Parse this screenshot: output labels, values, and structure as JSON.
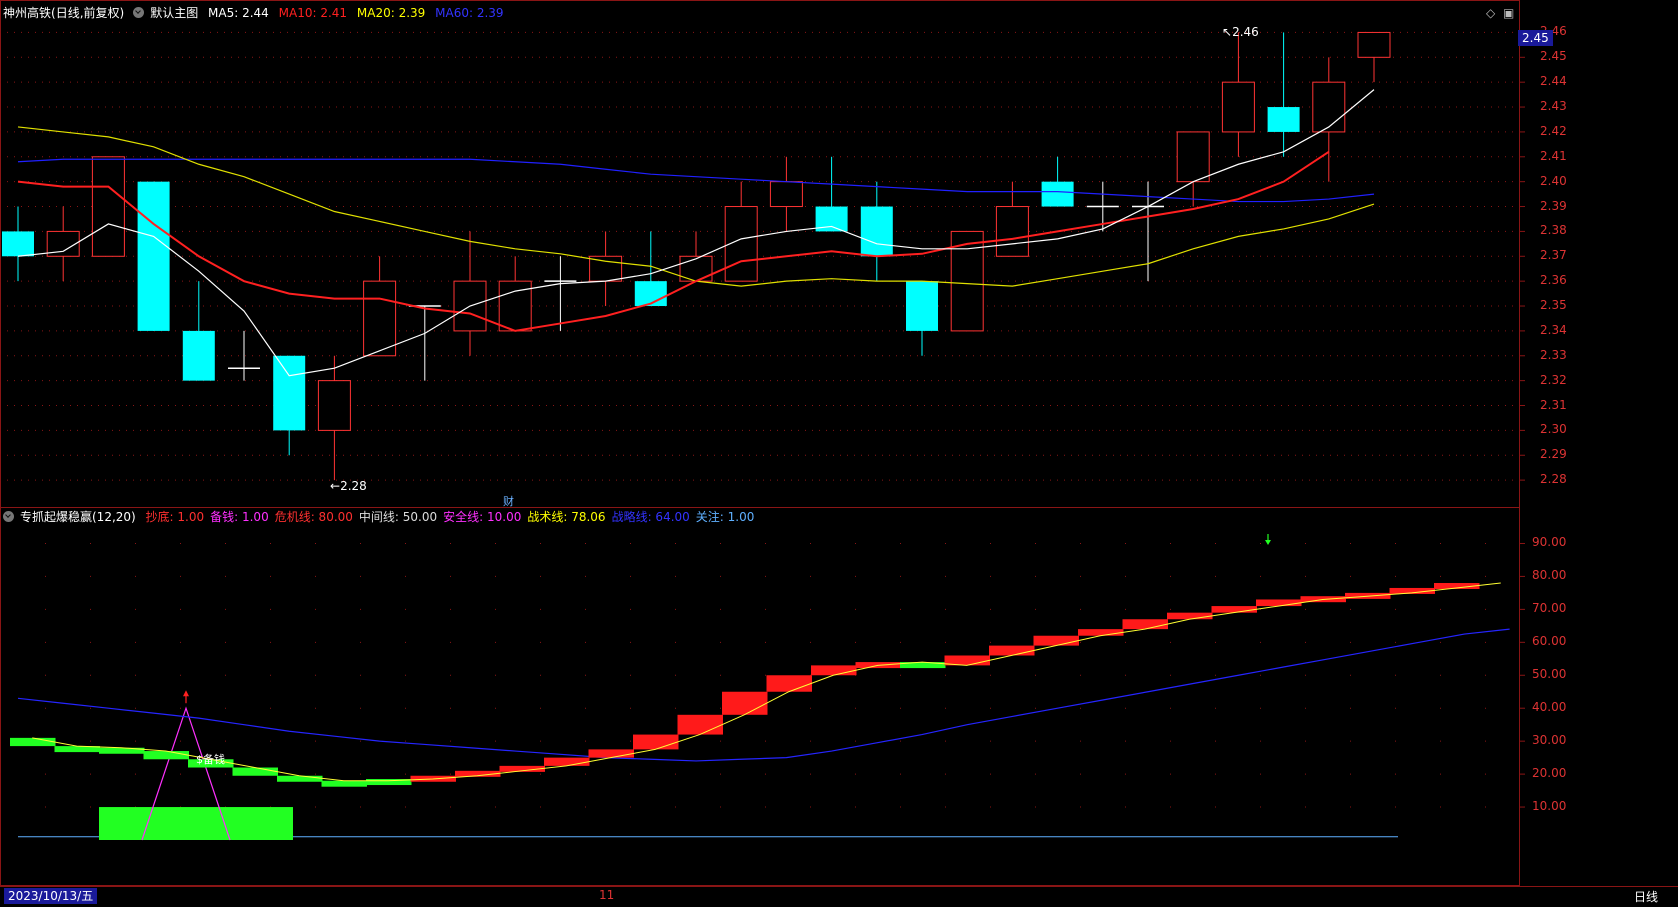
{
  "header": {
    "stock": "神州高铁",
    "period_mode": "(日线,前复权)",
    "template": "默认主图",
    "ma5": "MA5: 2.44",
    "ma10": "MA10: 2.41",
    "ma20": "MA20: 2.39",
    "ma60": "MA60: 2.39"
  },
  "indicator_header": {
    "name": "专抓起爆稳赢(12,20)",
    "items": [
      {
        "text": "抄底: 1.00",
        "color": "#ff3030"
      },
      {
        "text": "备钱: 1.00",
        "color": "#ff30ff"
      },
      {
        "text": "危机线: 80.00",
        "color": "#ff3030"
      },
      {
        "text": "中间线: 50.00",
        "color": "#dddddd"
      },
      {
        "text": "安全线: 10.00",
        "color": "#ff30ff"
      },
      {
        "text": "战术线: 78.06",
        "color": "#ffff00"
      },
      {
        "text": "战略线: 64.00",
        "color": "#3333ff"
      },
      {
        "text": "关注: 1.00",
        "color": "#5fb0ff"
      }
    ]
  },
  "current_price": "2.45",
  "high_annotation": "2.46",
  "low_annotation": "2.28",
  "finance_marker": "财",
  "signal_label": "$备钱",
  "bottom": {
    "date": "2023/10/13/五",
    "month": "11",
    "period": "日线"
  },
  "colors": {
    "up": "#ff3333",
    "down": "#00ffff",
    "ma5": "#ffffff",
    "ma10": "#ff2020",
    "ma20": "#e0e000",
    "ma60": "#2020ff",
    "grid": "#8a1515"
  },
  "chart_data": [
    {
      "type": "candlestick",
      "ylim": [
        2.27,
        2.465
      ],
      "yticks": [
        "2.46",
        "2.45",
        "2.44",
        "2.43",
        "2.42",
        "2.41",
        "2.40",
        "2.39",
        "2.38",
        "2.37",
        "2.36",
        "2.35",
        "2.34",
        "2.33",
        "2.32",
        "2.31",
        "2.30",
        "2.29",
        "2.28"
      ],
      "candles": [
        {
          "o": 2.38,
          "c": 2.37,
          "h": 2.39,
          "l": 2.36
        },
        {
          "o": 2.37,
          "c": 2.38,
          "h": 2.39,
          "l": 2.36
        },
        {
          "o": 2.37,
          "c": 2.41,
          "h": 2.41,
          "l": 2.37
        },
        {
          "o": 2.4,
          "c": 2.34,
          "h": 2.4,
          "l": 2.34
        },
        {
          "o": 2.34,
          "c": 2.32,
          "h": 2.36,
          "l": 2.32
        },
        {
          "o": 2.325,
          "c": 2.325,
          "h": 2.34,
          "l": 2.32
        },
        {
          "o": 2.33,
          "c": 2.3,
          "h": 2.33,
          "l": 2.29
        },
        {
          "o": 2.3,
          "c": 2.32,
          "h": 2.33,
          "l": 2.28
        },
        {
          "o": 2.33,
          "c": 2.36,
          "h": 2.37,
          "l": 2.33
        },
        {
          "o": 2.35,
          "c": 2.35,
          "h": 2.35,
          "l": 2.32
        },
        {
          "o": 2.34,
          "c": 2.36,
          "h": 2.38,
          "l": 2.33
        },
        {
          "o": 2.34,
          "c": 2.36,
          "h": 2.37,
          "l": 2.34
        },
        {
          "o": 2.36,
          "c": 2.36,
          "h": 2.37,
          "l": 2.34
        },
        {
          "o": 2.36,
          "c": 2.37,
          "h": 2.38,
          "l": 2.35
        },
        {
          "o": 2.36,
          "c": 2.35,
          "h": 2.38,
          "l": 2.35
        },
        {
          "o": 2.36,
          "c": 2.37,
          "h": 2.38,
          "l": 2.36
        },
        {
          "o": 2.36,
          "c": 2.39,
          "h": 2.4,
          "l": 2.36
        },
        {
          "o": 2.39,
          "c": 2.4,
          "h": 2.41,
          "l": 2.38
        },
        {
          "o": 2.39,
          "c": 2.38,
          "h": 2.41,
          "l": 2.38
        },
        {
          "o": 2.39,
          "c": 2.37,
          "h": 2.4,
          "l": 2.36
        },
        {
          "o": 2.36,
          "c": 2.34,
          "h": 2.36,
          "l": 2.33
        },
        {
          "o": 2.34,
          "c": 2.38,
          "h": 2.38,
          "l": 2.34
        },
        {
          "o": 2.37,
          "c": 2.39,
          "h": 2.4,
          "l": 2.37
        },
        {
          "o": 2.4,
          "c": 2.39,
          "h": 2.41,
          "l": 2.39
        },
        {
          "o": 2.39,
          "c": 2.39,
          "h": 2.4,
          "l": 2.38
        },
        {
          "o": 2.39,
          "c": 2.39,
          "h": 2.4,
          "l": 2.36
        },
        {
          "o": 2.4,
          "c": 2.42,
          "h": 2.42,
          "l": 2.39
        },
        {
          "o": 2.42,
          "c": 2.44,
          "h": 2.46,
          "l": 2.41
        },
        {
          "o": 2.43,
          "c": 2.42,
          "h": 2.46,
          "l": 2.41
        },
        {
          "o": 2.42,
          "c": 2.44,
          "h": 2.45,
          "l": 2.4
        },
        {
          "o": 2.45,
          "c": 2.46,
          "h": 2.46,
          "l": 2.44
        }
      ],
      "ma5": [
        2.37,
        2.372,
        2.383,
        2.378,
        2.364,
        2.348,
        2.322,
        2.325,
        2.332,
        2.339,
        2.35,
        2.356,
        2.359,
        2.36,
        2.363,
        2.369,
        2.377,
        2.38,
        2.382,
        2.375,
        2.373,
        2.373,
        2.375,
        2.377,
        2.381,
        2.39,
        2.4,
        2.407,
        2.412,
        2.422,
        2.437
      ],
      "ma10": [
        2.4,
        2.398,
        2.398,
        2.383,
        2.37,
        2.36,
        2.355,
        2.353,
        2.353,
        2.349,
        2.347,
        2.34,
        2.343,
        2.346,
        2.351,
        2.36,
        2.368,
        2.37,
        2.372,
        2.37,
        2.371,
        2.375,
        2.377,
        2.38,
        2.383,
        2.386,
        2.389,
        2.393,
        2.4,
        2.412
      ],
      "ma20": [
        2.422,
        2.42,
        2.418,
        2.414,
        2.407,
        2.402,
        2.395,
        2.388,
        2.384,
        2.38,
        2.376,
        2.373,
        2.371,
        2.368,
        2.366,
        2.36,
        2.358,
        2.36,
        2.361,
        2.36,
        2.36,
        2.359,
        2.358,
        2.361,
        2.364,
        2.367,
        2.373,
        2.378,
        2.381,
        2.385,
        2.391
      ],
      "ma60": [
        2.408,
        2.409,
        2.409,
        2.409,
        2.409,
        2.409,
        2.409,
        2.409,
        2.409,
        2.409,
        2.409,
        2.408,
        2.407,
        2.405,
        2.403,
        2.402,
        2.401,
        2.4,
        2.399,
        2.398,
        2.397,
        2.396,
        2.396,
        2.396,
        2.395,
        2.394,
        2.393,
        2.392,
        2.392,
        2.393,
        2.395
      ]
    },
    {
      "type": "indicator",
      "ylim": [
        0,
        95
      ],
      "yticks": [
        "90.00",
        "80.00",
        "70.00",
        "60.00",
        "50.00",
        "40.00",
        "30.00",
        "20.00",
        "10.00"
      ],
      "strategic_line": [
        43,
        41.5,
        40,
        38.5,
        37,
        35,
        33,
        31.5,
        30,
        29,
        28,
        27,
        26,
        25,
        24.5,
        24,
        24.5,
        25,
        27,
        29.5,
        32,
        35,
        37.5,
        40,
        42.5,
        45,
        47.5,
        50,
        52.5,
        55,
        57.5,
        60,
        62.5,
        64
      ],
      "tactical_line": [
        31,
        28.5,
        28,
        27,
        24.5,
        22,
        19.5,
        18,
        18,
        18.5,
        19.5,
        21,
        22.5,
        25,
        27.5,
        32,
        38,
        45,
        50,
        53,
        54,
        53,
        56,
        59,
        62,
        64,
        67,
        69,
        71,
        73,
        74,
        75,
        76.5,
        78
      ],
      "bottom_band": {
        "from_bar": 2,
        "to_bar": 6,
        "value": 10
      },
      "baseline": 1,
      "peak": {
        "bar": 4,
        "value": 40
      }
    }
  ]
}
